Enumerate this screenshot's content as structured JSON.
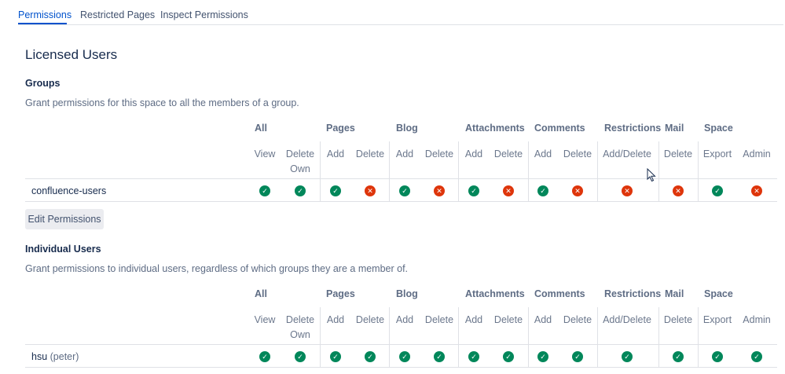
{
  "tabs": [
    {
      "label": "Permissions",
      "active": true
    },
    {
      "label": "Restricted Pages",
      "active": false
    },
    {
      "label": "Inspect Permissions",
      "active": false
    }
  ],
  "section_title": "Licensed Users",
  "groups": {
    "title": "Groups",
    "description": "Grant permissions for this space to all the members of a group.",
    "edit_button": "Edit Permissions",
    "rows": [
      {
        "name": "confluence-users",
        "name_suffix": "",
        "perms": [
          true,
          true,
          true,
          false,
          true,
          false,
          true,
          false,
          true,
          false,
          false,
          false,
          true,
          false
        ]
      }
    ]
  },
  "individual": {
    "title": "Individual Users",
    "description": "Grant permissions to individual users, regardless of which groups they are a member of.",
    "rows": [
      {
        "name": "hsu",
        "name_suffix": "(peter)",
        "perms": [
          true,
          true,
          true,
          true,
          true,
          true,
          true,
          true,
          true,
          true,
          true,
          true,
          true,
          true
        ]
      }
    ]
  },
  "columns": {
    "groups": [
      "All",
      "Pages",
      "Blog",
      "Attachments",
      "Comments",
      "Restrictions",
      "Mail",
      "Space"
    ],
    "subs": [
      "View",
      "Delete Own",
      "Add",
      "Delete",
      "Add",
      "Delete",
      "Add",
      "Delete",
      "Add",
      "Delete",
      "Add/Delete",
      "Delete",
      "Export",
      "Admin"
    ]
  },
  "icons": {
    "yes": "check-circle-icon",
    "no": "cross-circle-icon"
  },
  "colors": {
    "accent": "#0052cc",
    "yes": "#00875a",
    "no": "#de350b"
  }
}
